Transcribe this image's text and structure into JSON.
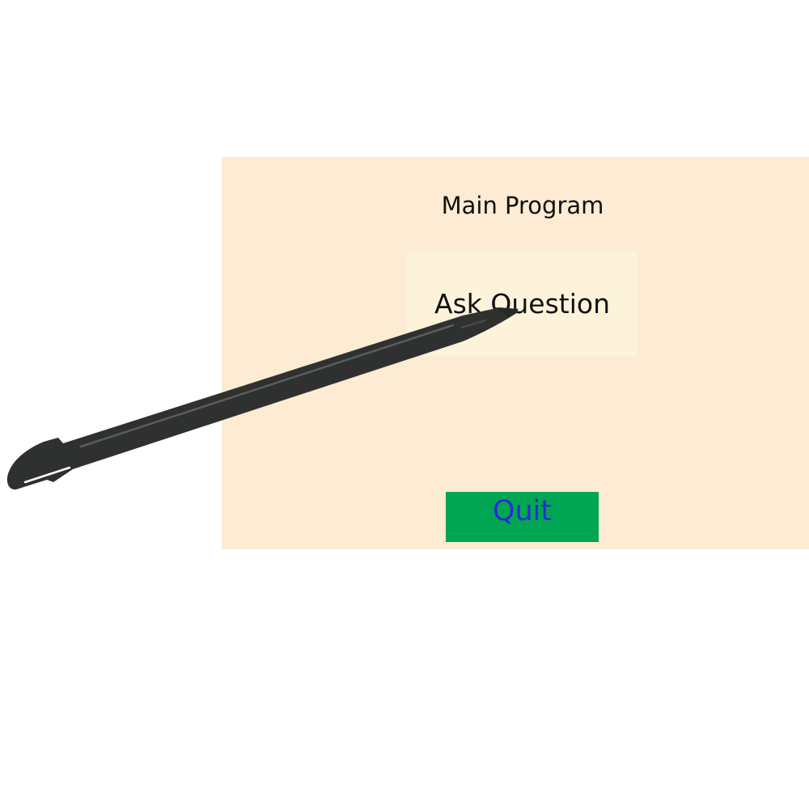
{
  "window": {
    "title": "Main Program"
  },
  "buttons": {
    "ask_label": "Ask Question",
    "quit_label": "Quit"
  },
  "icons": {
    "pointer": "stylus-icon"
  },
  "colors": {
    "window_background": "#fdebd3",
    "ask_button_background": "#fcf3da",
    "quit_button_background": "#00a652",
    "quit_button_text": "#2b2bd6",
    "stylus": "#2f3130"
  }
}
